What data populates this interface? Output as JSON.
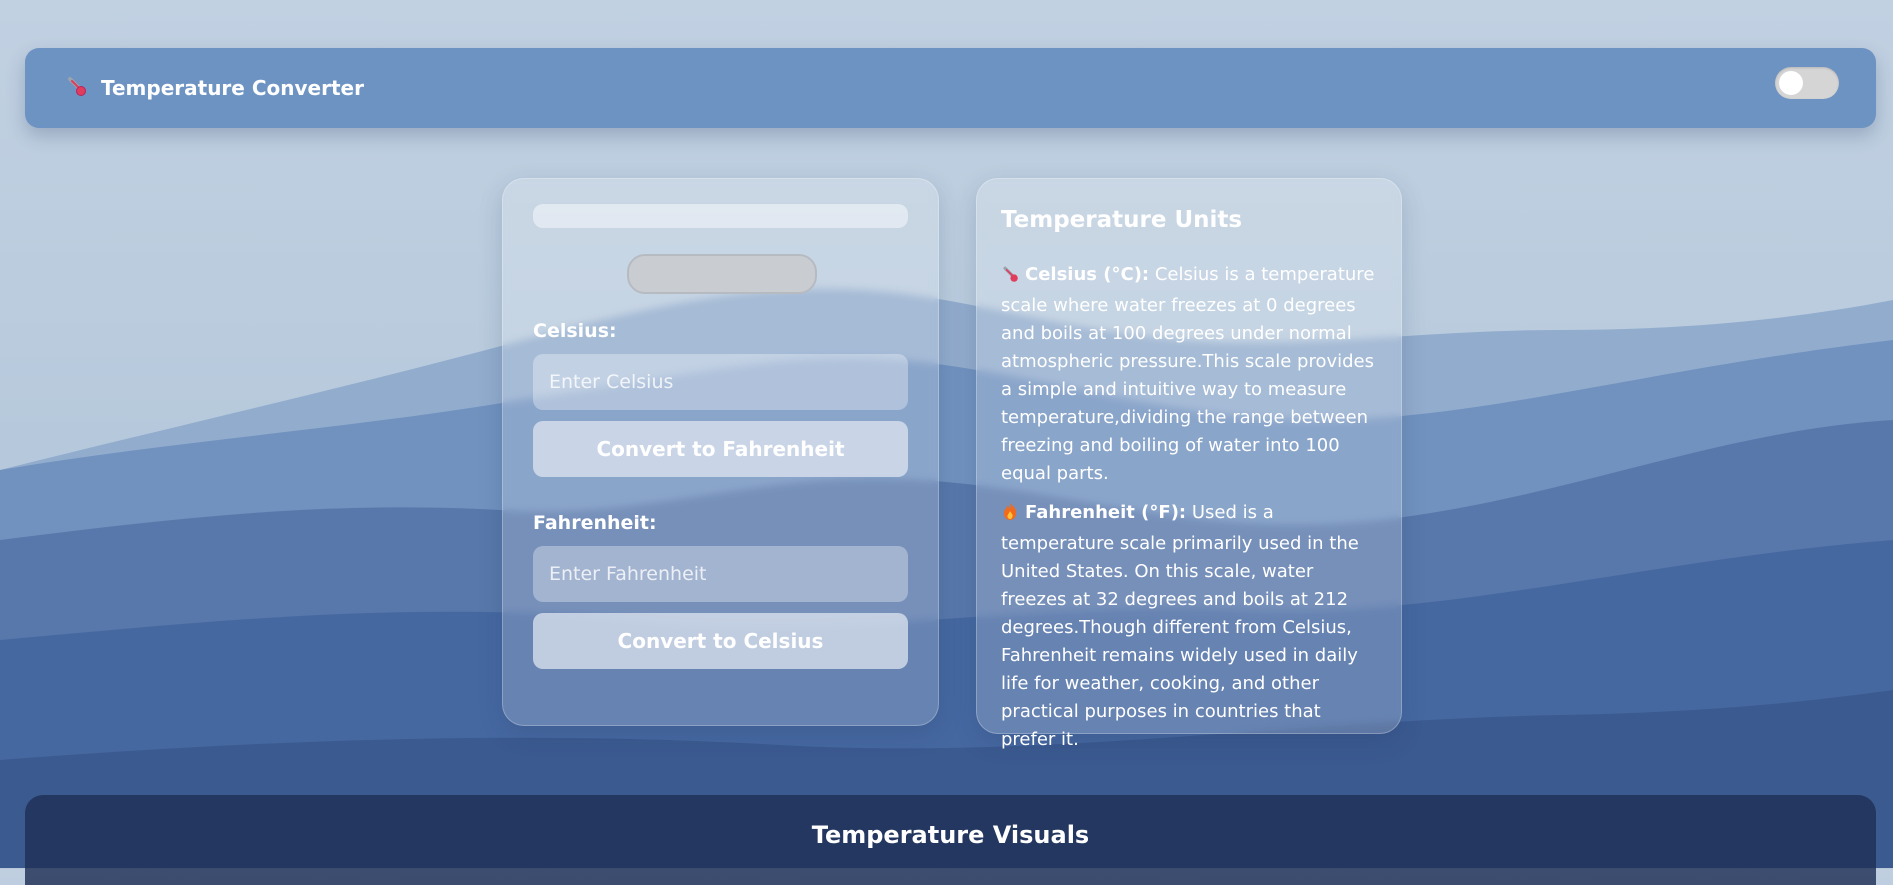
{
  "header": {
    "title": "Temperature Converter",
    "brand_icon": "thermometer-icon",
    "theme_toggle_on": false
  },
  "converter": {
    "celsius_label": "Celsius:",
    "celsius_placeholder": "Enter Celsius",
    "celsius_value": "",
    "to_fahrenheit_label": "Convert to Fahrenheit",
    "fahrenheit_label": "Fahrenheit:",
    "fahrenheit_placeholder": "Enter Fahrenheit",
    "fahrenheit_value": "",
    "to_celsius_label": "Convert to Celsius"
  },
  "info": {
    "title": "Temperature Units",
    "celsius": {
      "icon": "thermometer-icon",
      "term": "Celsius (°C):",
      "text": " Celsius is a temperature scale where water freezes at 0 degrees and boils at 100 degrees under normal atmospheric pressure.This scale provides a simple and intuitive way to measure temperature,dividing the range between freezing and boiling of water into 100 equal parts."
    },
    "fahrenheit": {
      "icon": "fire-icon",
      "term": "Fahrenheit (°F):",
      "text": " Used is a temperature scale primarily used in the United States. On this scale, water freezes at 32 degrees and boils at 212 degrees.Though different from Celsius, Fahrenheit remains widely used in daily life for weather, cooking, and other practical purposes in countries that prefer it."
    }
  },
  "footer": {
    "title": "Temperature Visuals"
  },
  "colors": {
    "navbar": "#6d93c3",
    "footer": "#1e3055",
    "toggle": "#d5d5d5"
  }
}
